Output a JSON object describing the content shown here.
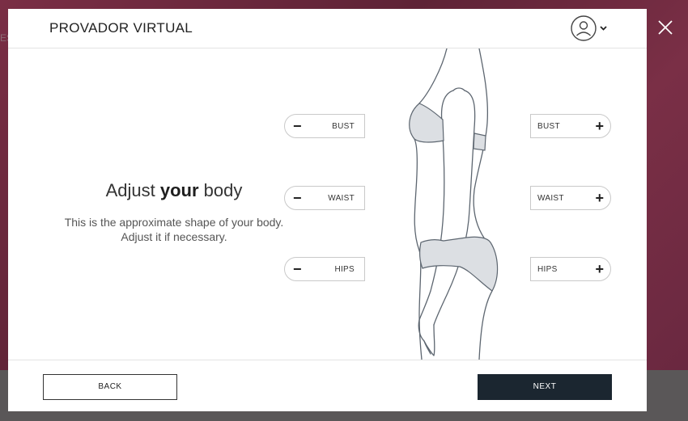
{
  "app": {
    "title": "PROVADOR VIRTUAL"
  },
  "background": {
    "ghost_text": "ES"
  },
  "main": {
    "heading_prefix": "Adjust ",
    "heading_bold": "your",
    "heading_suffix": " body",
    "description": "This is the approximate shape of your body. Adjust it if necessary."
  },
  "adjust": {
    "decrease": [
      {
        "label": "BUST",
        "symbol": "−"
      },
      {
        "label": "WAIST",
        "symbol": "−"
      },
      {
        "label": "HIPS",
        "symbol": "−"
      }
    ],
    "increase": [
      {
        "label": "BUST",
        "symbol": "+"
      },
      {
        "label": "WAIST",
        "symbol": "+"
      },
      {
        "label": "HIPS",
        "symbol": "+"
      }
    ]
  },
  "footer": {
    "back_label": "BACK",
    "next_label": "NEXT"
  },
  "icons": {
    "close": "close-icon",
    "user": "user-avatar-icon",
    "chevron": "chevron-down-icon"
  },
  "colors": {
    "accent_dark": "#1b2630",
    "backdrop": "#6e2a3e",
    "garment_fill": "#dcdfe3"
  }
}
